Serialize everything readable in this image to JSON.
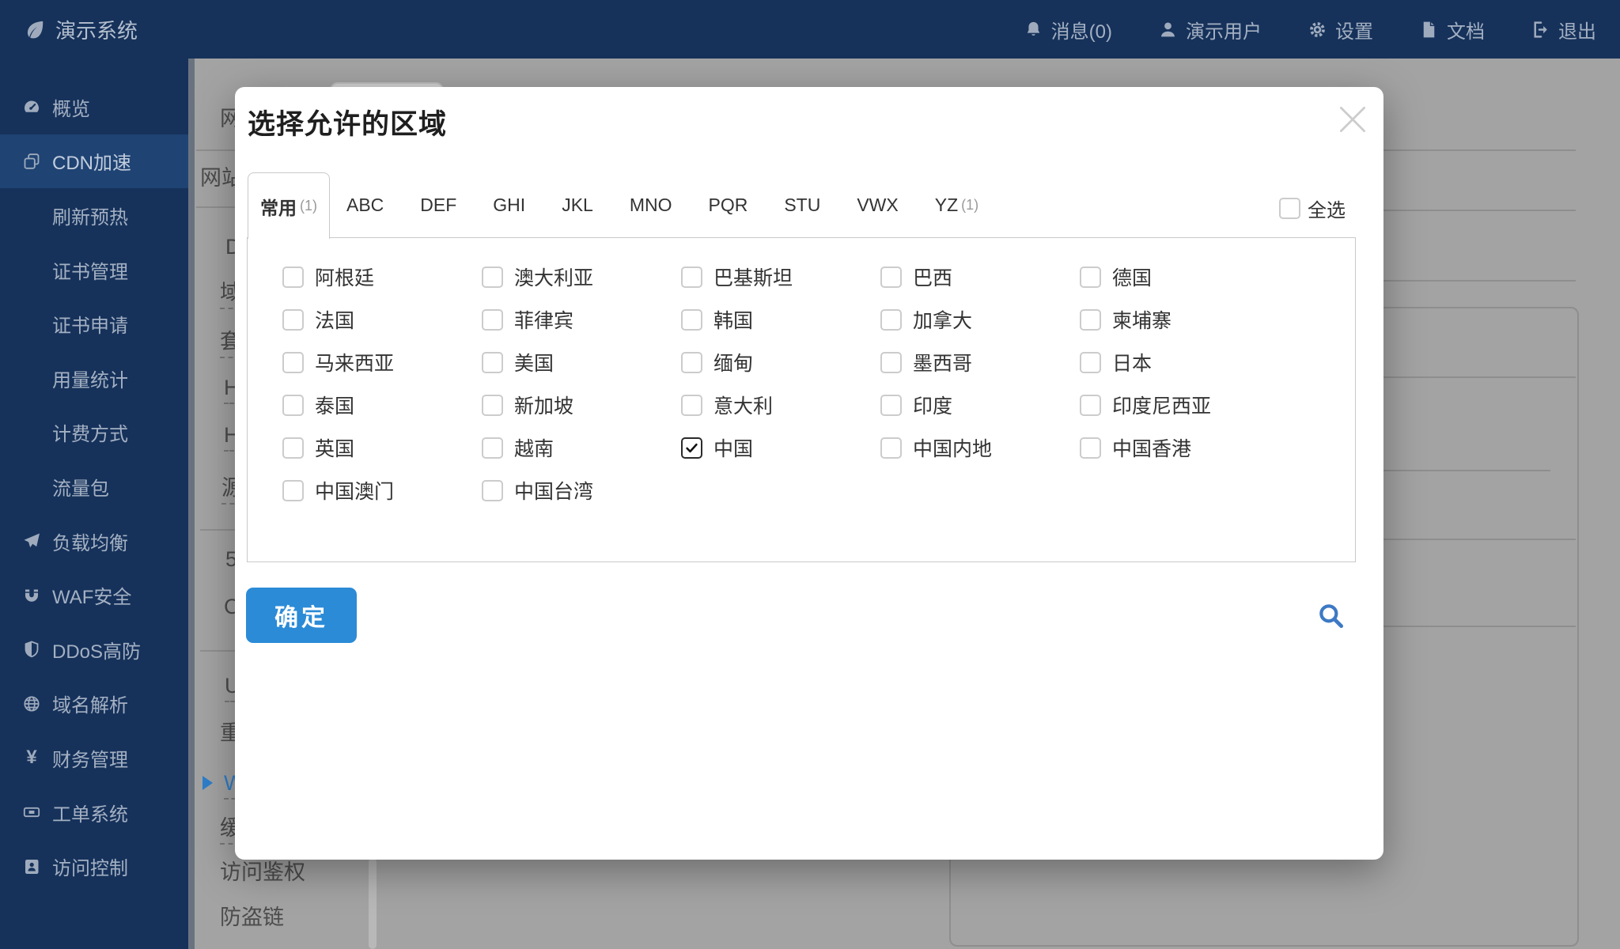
{
  "colors": {
    "topbar_bg": "#16325b",
    "sidebar_active_bg": "#1f4373",
    "accent_blue": "#2b8bd7",
    "link_blue": "#2f7ec9",
    "search_icon_blue": "#3d79c4"
  },
  "topbar": {
    "brand": "演示系统",
    "menu": [
      {
        "icon": "bell-icon",
        "label": "消息(0)"
      },
      {
        "icon": "user-icon",
        "label": "演示用户"
      },
      {
        "icon": "gear-icon",
        "label": "设置"
      },
      {
        "icon": "file-icon",
        "label": "文档"
      },
      {
        "icon": "signout-icon",
        "label": "退出"
      }
    ]
  },
  "sidebar": {
    "items": [
      {
        "icon": "gauge-icon",
        "label": "概览"
      },
      {
        "icon": "clone-icon",
        "label": "CDN加速",
        "active": true
      },
      {
        "label": "刷新预热",
        "sub": true
      },
      {
        "label": "证书管理",
        "sub": true
      },
      {
        "label": "证书申请",
        "sub": true
      },
      {
        "label": "用量统计",
        "sub": true
      },
      {
        "label": "计费方式",
        "sub": true
      },
      {
        "label": "流量包",
        "sub": true
      },
      {
        "icon": "paper-plane-icon",
        "label": "负载均衡"
      },
      {
        "icon": "magnet-icon",
        "label": "WAF安全"
      },
      {
        "icon": "shield-icon",
        "label": "DDoS高防"
      },
      {
        "icon": "globe-icon",
        "label": "域名解析"
      },
      {
        "icon": "yen-icon",
        "label": "财务管理"
      },
      {
        "icon": "ticket-icon",
        "label": "工单系统"
      },
      {
        "icon": "id-card-icon",
        "label": "访问控制"
      }
    ]
  },
  "page_background": {
    "anchor_fragments": [
      "网",
      "网站",
      "D",
      "域",
      "套",
      "H",
      "H",
      "源",
      "5",
      "C",
      "U",
      "重",
      "W",
      "缓",
      "访问鉴权",
      "防盗链"
    ]
  },
  "modal": {
    "title": "选择允许的区域",
    "tabs": [
      {
        "label": "常用",
        "count": "(1)",
        "active": true
      },
      {
        "label": "ABC"
      },
      {
        "label": "DEF"
      },
      {
        "label": "GHI"
      },
      {
        "label": "JKL"
      },
      {
        "label": "MNO"
      },
      {
        "label": "PQR"
      },
      {
        "label": "STU"
      },
      {
        "label": "VWX"
      },
      {
        "label": "YZ",
        "count": "(1)"
      }
    ],
    "select_all_label": "全选",
    "regions": [
      {
        "label": "阿根廷",
        "checked": false
      },
      {
        "label": "澳大利亚",
        "checked": false
      },
      {
        "label": "巴基斯坦",
        "checked": false
      },
      {
        "label": "巴西",
        "checked": false
      },
      {
        "label": "德国",
        "checked": false
      },
      {
        "label": "法国",
        "checked": false
      },
      {
        "label": "菲律宾",
        "checked": false
      },
      {
        "label": "韩国",
        "checked": false
      },
      {
        "label": "加拿大",
        "checked": false
      },
      {
        "label": "柬埔寨",
        "checked": false
      },
      {
        "label": "马来西亚",
        "checked": false
      },
      {
        "label": "美国",
        "checked": false
      },
      {
        "label": "缅甸",
        "checked": false
      },
      {
        "label": "墨西哥",
        "checked": false
      },
      {
        "label": "日本",
        "checked": false
      },
      {
        "label": "泰国",
        "checked": false
      },
      {
        "label": "新加坡",
        "checked": false
      },
      {
        "label": "意大利",
        "checked": false
      },
      {
        "label": "印度",
        "checked": false
      },
      {
        "label": "印度尼西亚",
        "checked": false
      },
      {
        "label": "英国",
        "checked": false
      },
      {
        "label": "越南",
        "checked": false
      },
      {
        "label": "中国",
        "checked": true
      },
      {
        "label": "中国内地",
        "checked": false
      },
      {
        "label": "中国香港",
        "checked": false
      },
      {
        "label": "中国澳门",
        "checked": false
      },
      {
        "label": "中国台湾",
        "checked": false
      }
    ],
    "confirm_label": "确定"
  }
}
